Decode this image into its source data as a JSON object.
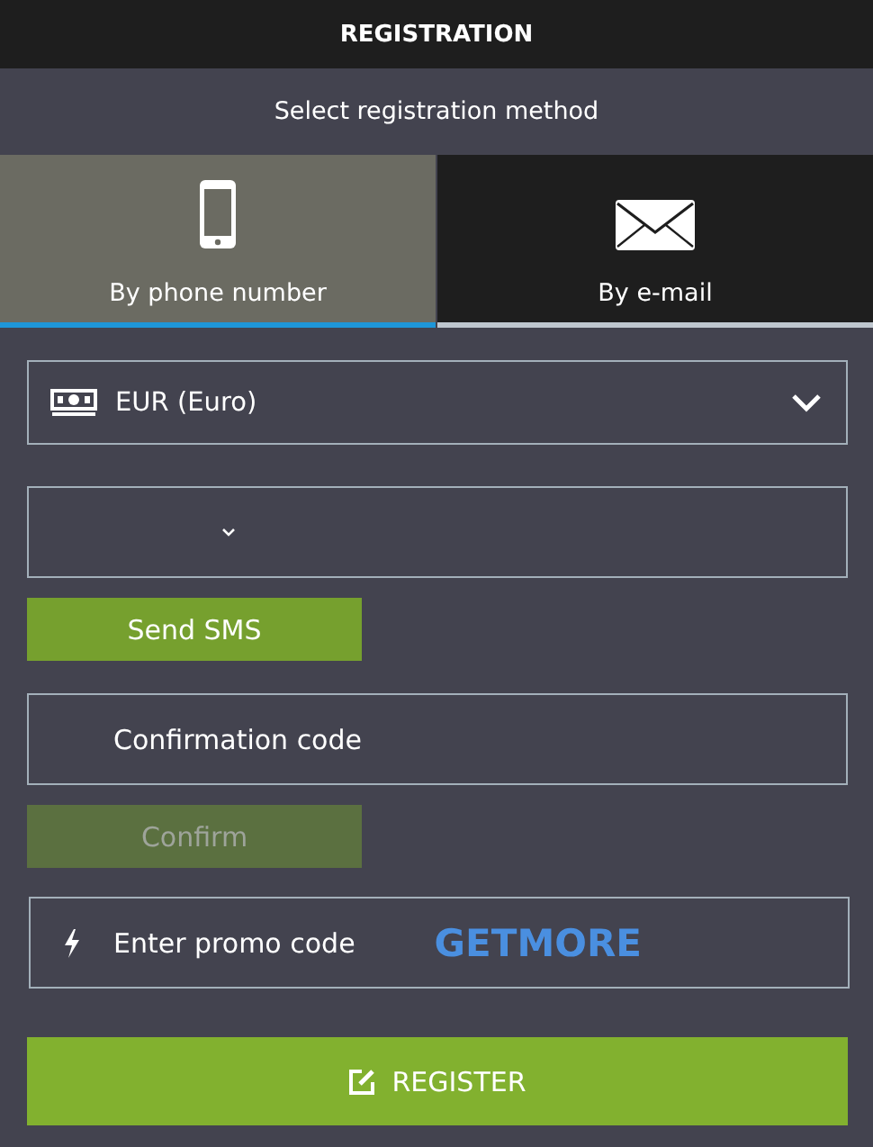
{
  "header": {
    "title": "REGISTRATION"
  },
  "subtitle": "Select registration method",
  "tabs": [
    {
      "kind": "phone",
      "label": "By phone number",
      "selected": true
    },
    {
      "kind": "email",
      "label": "By e-mail",
      "selected": false
    }
  ],
  "currency": {
    "value": "EUR (Euro)"
  },
  "send_button": {
    "label": "Send SMS",
    "disabled": false
  },
  "confirmation": {
    "placeholder": "Confirmation code"
  },
  "confirm_button": {
    "label": "Confirm",
    "disabled": true
  },
  "promo": {
    "placeholder": "Enter promo code",
    "overlay": "GETMORE"
  },
  "register_button": {
    "label": "REGISTER"
  }
}
